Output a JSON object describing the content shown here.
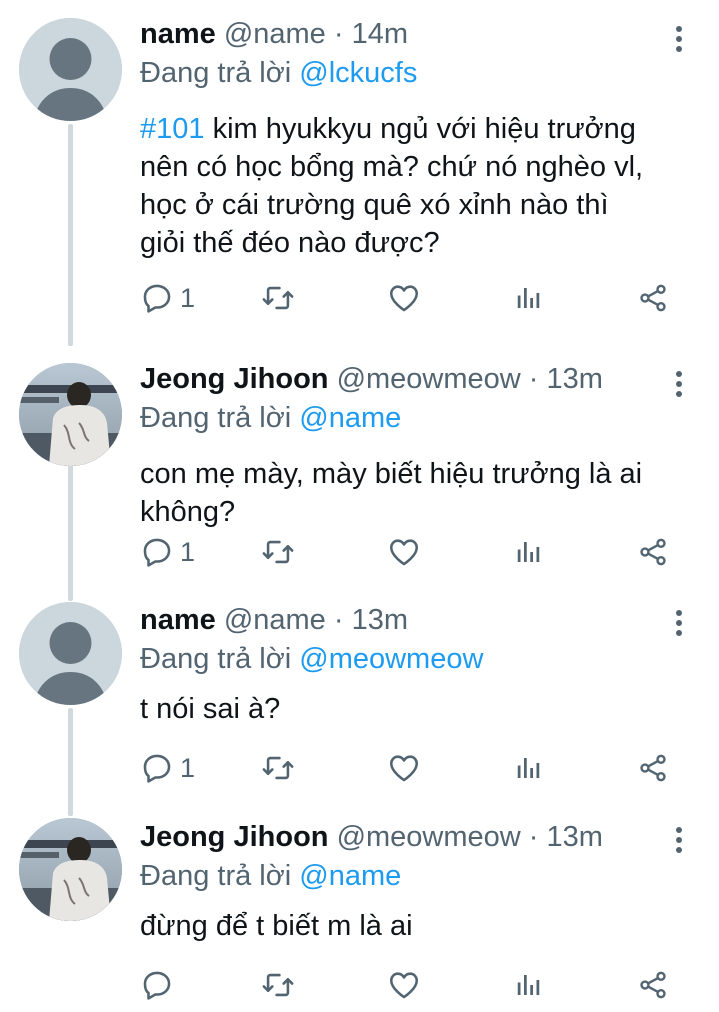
{
  "tweets": [
    {
      "display_name": "name",
      "handle": "@name",
      "time": "· 14m",
      "replying_prefix": "Đang trả lời",
      "replying_to": "@lckucfs",
      "hashtag": "#101",
      "text_line1": " kim hyukkyu ngủ với hiệu trưởng",
      "text_line2": "nên có học bổng mà? chứ nó nghèo vl,",
      "text_line3": "học ở cái trường quê xó xỉnh nào thì",
      "text_line4": "giỏi thế đéo nào được?",
      "reply_count": "1",
      "avatar": "default-avatar"
    },
    {
      "display_name": "Jeong Jihoon",
      "handle": "@meowmeow",
      "time": "· 13m",
      "replying_prefix": "Đang trả lời",
      "replying_to": "@name",
      "text_line1": "con mẹ mày, mày biết hiệu trưởng là ai",
      "text_line2": "không?",
      "reply_count": "1",
      "avatar": "photo-avatar"
    },
    {
      "display_name": "name",
      "handle": "@name",
      "time": "· 13m",
      "replying_prefix": "Đang trả lời",
      "replying_to": "@meowmeow",
      "text_line1": "t nói sai à?",
      "reply_count": "1",
      "avatar": "default-avatar"
    },
    {
      "display_name": "Jeong Jihoon",
      "handle": "@meowmeow",
      "time": "· 13m",
      "replying_prefix": "Đang trả lời",
      "replying_to": "@name",
      "text_line1": "đừng để t biết m là ai",
      "reply_count": "",
      "avatar": "photo-avatar"
    }
  ],
  "icons": [
    "reply-icon",
    "retweet-icon",
    "like-icon",
    "views-icon",
    "share-icon",
    "more-options-icon"
  ],
  "colors": {
    "accent": "#1d9bf0",
    "text": "#0f1419",
    "secondary_text": "#536471",
    "thread_line": "#cfd9de",
    "default_avatar": "#ccd6dd"
  }
}
